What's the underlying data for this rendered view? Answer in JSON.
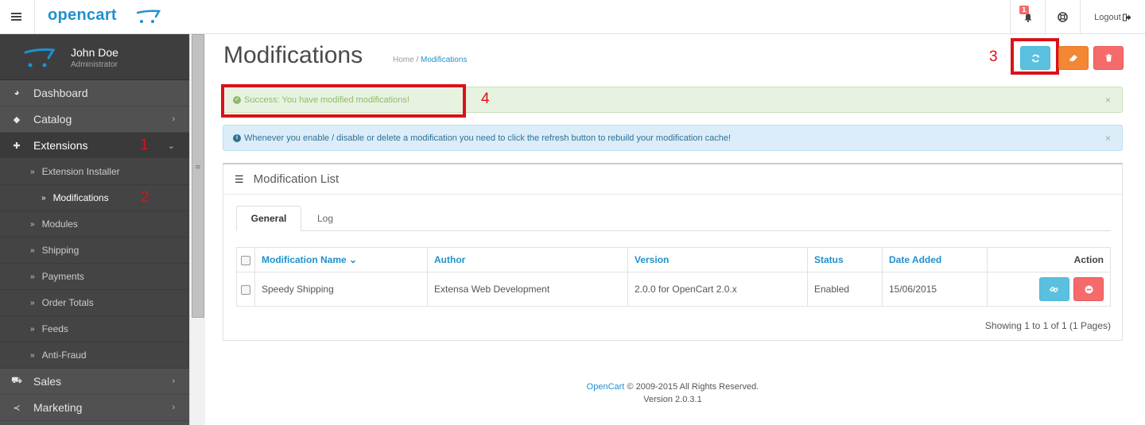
{
  "header": {
    "logo_text": "opencart",
    "notifications_count": "1",
    "logout_label": "Logout"
  },
  "profile": {
    "name": "John Doe",
    "role": "Administrator"
  },
  "sidebar": {
    "items": [
      {
        "label": "Dashboard",
        "icon": "dashboard-icon"
      },
      {
        "label": "Catalog",
        "icon": "tag-icon"
      },
      {
        "label": "Extensions",
        "icon": "puzzle-icon"
      },
      {
        "label": "Sales",
        "icon": "cart-icon"
      },
      {
        "label": "Marketing",
        "icon": "share-icon"
      }
    ],
    "extensions_sub": [
      "Extension Installer",
      "Modifications",
      "Modules",
      "Shipping",
      "Payments",
      "Order Totals",
      "Feeds",
      "Anti-Fraud"
    ]
  },
  "page": {
    "title": "Modifications",
    "breadcrumb": [
      "Home",
      "Modifications"
    ]
  },
  "annotations": [
    "1",
    "2",
    "3",
    "4"
  ],
  "alerts": {
    "success": "Success: You have modified modifications!",
    "info": "Whenever you enable / disable or delete a modification you need to click the refresh button to rebuild your modification cache!",
    "close": "×"
  },
  "panel": {
    "title": "Modification List",
    "tabs": [
      "General",
      "Log"
    ],
    "columns": [
      "Modification Name",
      "Author",
      "Version",
      "Status",
      "Date Added",
      "Action"
    ],
    "rows": [
      {
        "name": "Speedy Shipping",
        "author": "Extensa Web Development",
        "version": "2.0.0 for OpenCart 2.0.x",
        "status": "Enabled",
        "date": "15/06/2015"
      }
    ],
    "pagination": "Showing 1 to 1 of 1 (1 Pages)"
  },
  "footer": {
    "brand": "OpenCart",
    "copyright": "© 2009-2015 All Rights Reserved.",
    "version": "Version 2.0.3.1"
  },
  "colors": {
    "brand_blue": "#1e91cf",
    "sidebar_bg": "#515151",
    "annotation_red": "#d9121a",
    "info_button": "#5bc0de",
    "warning_button": "#f38733",
    "danger_button": "#f56b6b"
  }
}
